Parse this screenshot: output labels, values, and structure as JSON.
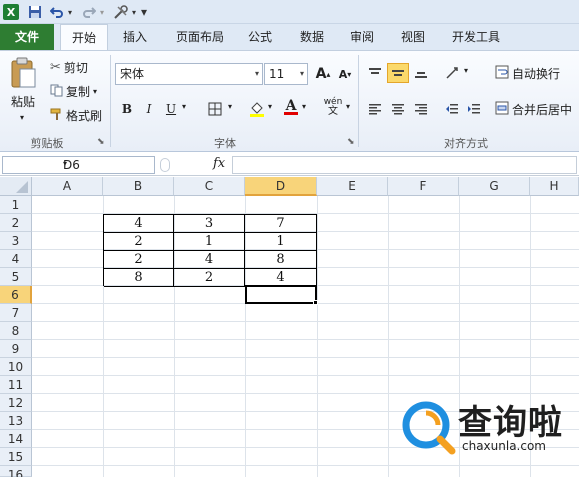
{
  "qat": {
    "excel_icon": "excel-app-icon",
    "save_icon": "save-icon",
    "undo_icon": "undo-icon",
    "redo_icon": "redo-icon",
    "tools_icon": "tools-icon",
    "customize": "▾"
  },
  "tabs": [
    {
      "label": "文件"
    },
    {
      "label": "开始"
    },
    {
      "label": "插入"
    },
    {
      "label": "页面布局"
    },
    {
      "label": "公式"
    },
    {
      "label": "数据"
    },
    {
      "label": "审阅"
    },
    {
      "label": "视图"
    },
    {
      "label": "开发工具"
    }
  ],
  "ribbon": {
    "clipboard": {
      "paste": "粘贴",
      "cut": "剪切",
      "copy": "复制",
      "format_painter": "格式刷",
      "label": "剪贴板"
    },
    "font": {
      "name": "宋体",
      "size": "11",
      "grow": "A",
      "shrink": "A",
      "bold": "B",
      "italic": "I",
      "underline": "U",
      "phonetic": "wén",
      "label": "字体",
      "fill_color": "#ffff00",
      "font_color": "#e00000"
    },
    "alignment": {
      "wrap": "自动换行",
      "merge": "合并后居中",
      "label": "对齐方式"
    }
  },
  "formula_bar": {
    "name_box": "D6",
    "fx": "fx",
    "value": ""
  },
  "columns": [
    "A",
    "B",
    "C",
    "D",
    "E",
    "F",
    "G",
    "H"
  ],
  "rows": [
    "1",
    "2",
    "3",
    "4",
    "5",
    "6",
    "7",
    "8",
    "9",
    "10",
    "11",
    "12",
    "13",
    "14",
    "15",
    "16"
  ],
  "cells": {
    "B2": "4",
    "C2": "3",
    "D2": "7",
    "B3": "2",
    "C3": "1",
    "D3": "1",
    "B4": "2",
    "C4": "4",
    "D4": "8",
    "B5": "8",
    "C5": "2",
    "D5": "4"
  },
  "selected_cell": "D6",
  "watermark": {
    "title": "查询啦",
    "site": "chaxunla.com"
  }
}
